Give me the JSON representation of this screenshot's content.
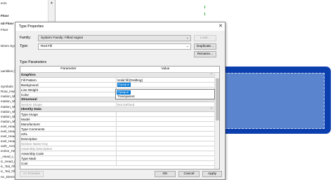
{
  "browser": {
    "rows": [
      "ect1",
      "Floor",
      "nd Floor",
      "Floor",
      "Dimm Symbol",
      "",
      "uantities (s",
      "Symbols",
      "Rout_Head",
      "mation_Mo",
      "mation_Mo",
      "mation_Mo",
      "mation_Mo",
      "mation_Mo",
      "mation_Mo",
      "evel_Head_U",
      "evel_Head_T",
      "evel_Head_C",
      "evel_Head_C",
      "outh_Arrow",
      "ection_Head",
      "_Head_L",
      "ic_Head_F",
      "ic_Tail_Filled",
      "ic_Tail_Filled",
      "nn_Direction"
    ]
  },
  "dialog": {
    "title": "Type Properties",
    "family_label": "Family:",
    "family_value": "System Family: Filled region",
    "type_label": "Type:",
    "type_value": "Red Fill",
    "load_button": "Load...",
    "duplicate_button": "Duplicate...",
    "rename_button": "Rename...",
    "type_parameters_label": "Type Parameters",
    "col_parameter": "Parameter",
    "col_value": "Value",
    "groups": {
      "graphics": "Graphics",
      "structural": "Structural",
      "identity": "Identity Data"
    },
    "graphics_rows": [
      {
        "p": "Fill Pattern",
        "v": "Solid fill [Drafting]"
      },
      {
        "p": "Background",
        "v": "Opaque"
      },
      {
        "p": "Line Weight",
        "v": ""
      },
      {
        "p": "Color",
        "v": ""
      }
    ],
    "structural_rows": [
      {
        "p": "Section Shape",
        "v": "Not Defined"
      }
    ],
    "identity_rows": [
      {
        "p": "Type Image",
        "v": ""
      },
      {
        "p": "Model",
        "v": ""
      },
      {
        "p": "Manufacturer",
        "v": ""
      },
      {
        "p": "Type Comments",
        "v": ""
      },
      {
        "p": "URL",
        "v": ""
      },
      {
        "p": "Description",
        "v": ""
      },
      {
        "p": "Section Name Key",
        "v": ""
      },
      {
        "p": "Assembly Description",
        "v": ""
      },
      {
        "p": "Assembly Code",
        "v": ""
      },
      {
        "p": "Type Mark",
        "v": ""
      },
      {
        "p": "Cost",
        "v": ""
      }
    ],
    "dropdown_options": [
      "Opaque",
      "Transparent"
    ],
    "preview_button": "<< Preview",
    "ok_button": "OK",
    "cancel_button": "Cancel",
    "apply_button": "Apply"
  },
  "colors": {
    "region_outer": "#0c3fae",
    "region_inner": "#5b84cf",
    "selection": "#0078d7"
  }
}
